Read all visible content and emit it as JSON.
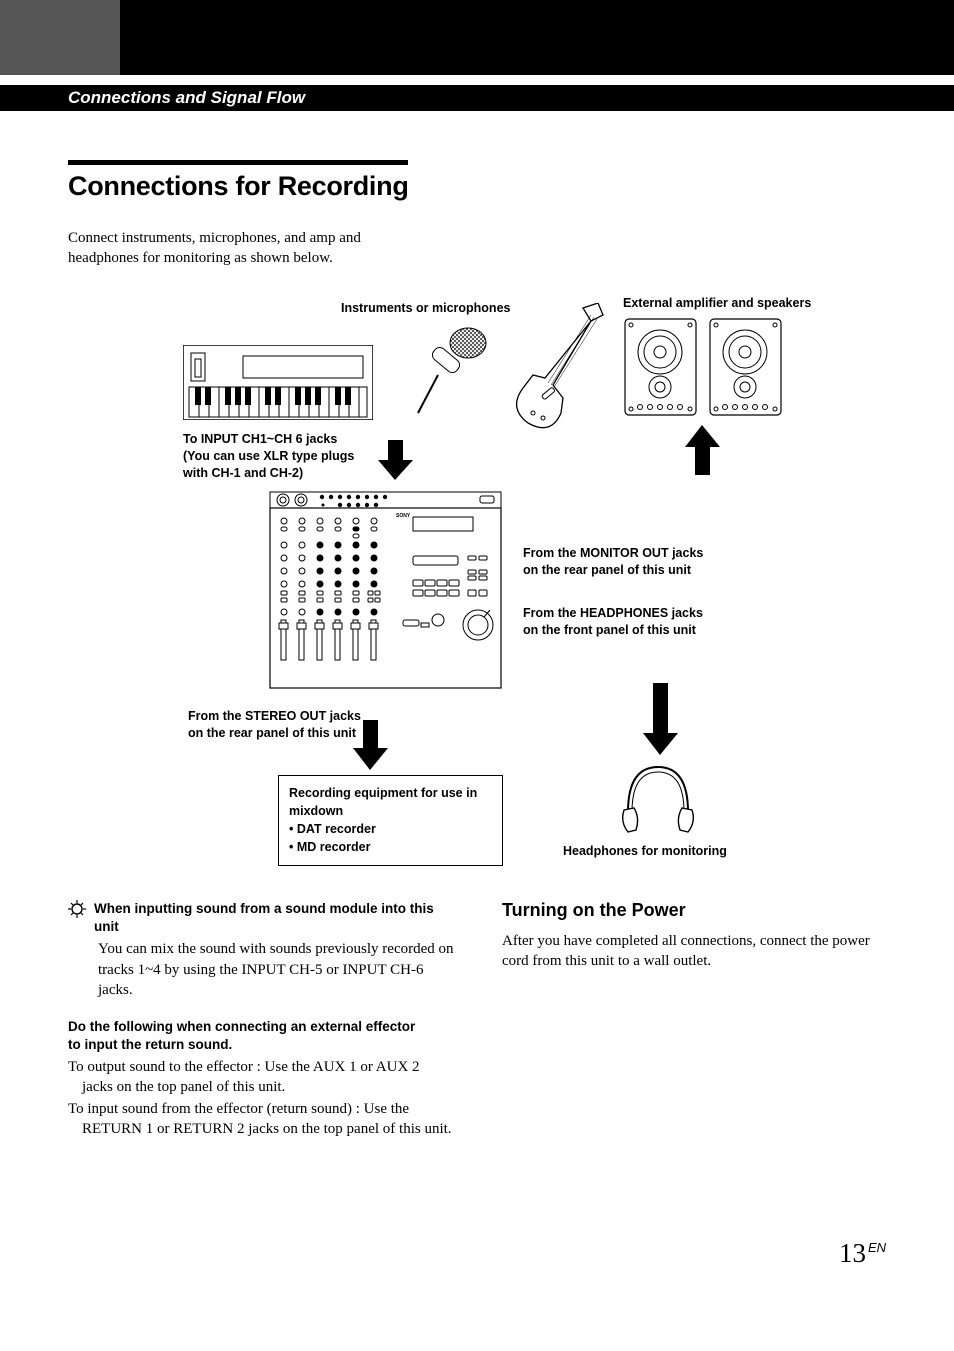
{
  "section_bar": "Connections and Signal Flow",
  "title": "Connections for Recording",
  "intro": "Connect instruments, microphones, and amp and headphones for monitoring as shown below.",
  "diagram": {
    "label_instruments": "Instruments or microphones",
    "label_external": "External amplifier and speakers",
    "label_input_jacks_l1": "To INPUT CH1~CH 6 jacks",
    "label_input_jacks_l2": "(You can use XLR type plugs",
    "label_input_jacks_l3": "with CH-1 and CH-2)",
    "label_monitor_l1": "From the MONITOR OUT jacks",
    "label_monitor_l2": "on the rear panel of this unit",
    "label_headphones_l1": "From the HEADPHONES jacks",
    "label_headphones_l2": "on the front panel of this unit",
    "label_stereo_l1": "From the STEREO OUT jacks",
    "label_stereo_l2": "on the rear panel of this unit",
    "box_line1": "Recording equipment for use in",
    "box_line2": "mixdown",
    "box_line3": "• DAT recorder",
    "box_line4": "• MD recorder",
    "label_hp": "Headphones for monitoring"
  },
  "tip": {
    "heading_l1": "When inputting sound from a sound module into this",
    "heading_l2": "unit",
    "body": "You can mix the sound with sounds previously recorded on tracks 1~4 by using the INPUT CH-5 or INPUT CH-6 jacks."
  },
  "effector": {
    "heading_l1": "Do the following when connecting an external effector",
    "heading_l2": "to input the return sound.",
    "line1": "To output sound to the effector : Use the AUX 1 or AUX 2 jacks on the top panel of this unit.",
    "line2": "To input sound from the effector (return sound) : Use the RETURN 1 or RETURN 2 jacks on the top panel of this unit."
  },
  "power": {
    "heading": "Turning on the Power",
    "body": "After you have completed all connections, connect the power cord from this unit to a wall outlet."
  },
  "pagenum": "13",
  "pagelang": "EN"
}
